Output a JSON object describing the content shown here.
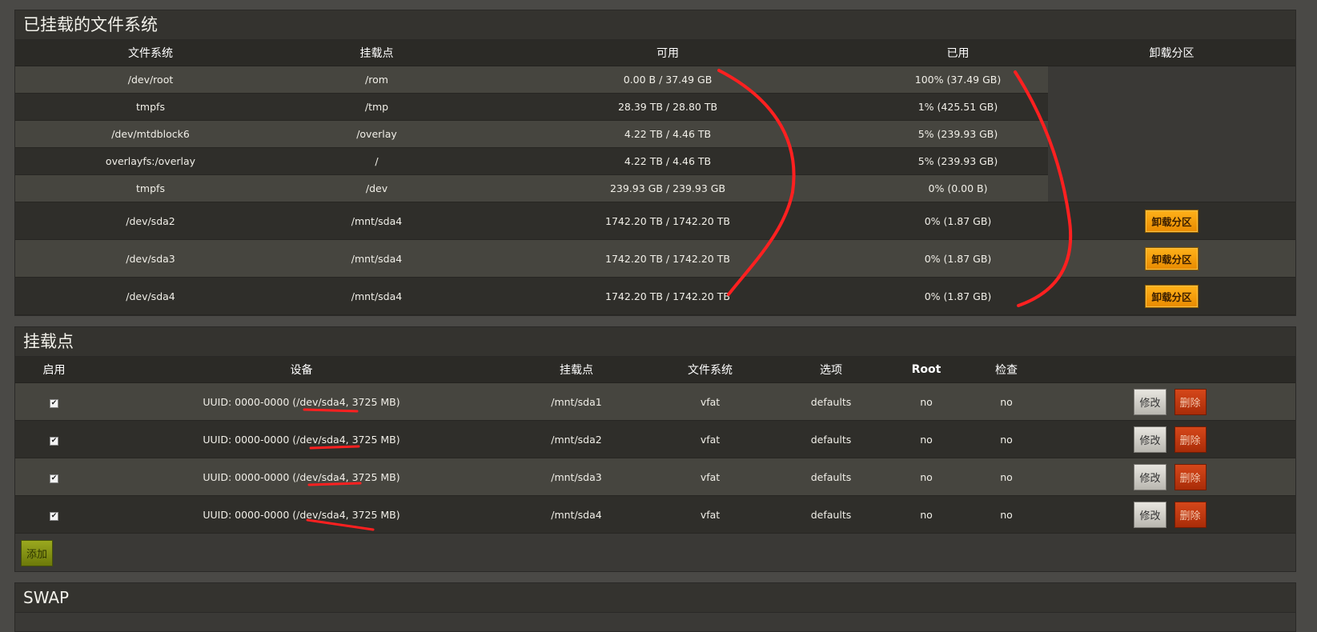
{
  "mounted": {
    "title": "已挂载的文件系统",
    "headers": [
      "文件系统",
      "挂载点",
      "可用",
      "已用",
      "卸载分区"
    ],
    "rows": [
      {
        "fs": "/dev/root",
        "mount": "/rom",
        "avail": "0.00 B / 37.49 GB",
        "used": "100% (37.49 GB)"
      },
      {
        "fs": "tmpfs",
        "mount": "/tmp",
        "avail": "28.39 TB / 28.80 TB",
        "used": "1% (425.51 GB)"
      },
      {
        "fs": "/dev/mtdblock6",
        "mount": "/overlay",
        "avail": "4.22 TB / 4.46 TB",
        "used": "5% (239.93 GB)"
      },
      {
        "fs": "overlayfs:/overlay",
        "mount": "/",
        "avail": "4.22 TB / 4.46 TB",
        "used": "5% (239.93 GB)"
      },
      {
        "fs": "tmpfs",
        "mount": "/dev",
        "avail": "239.93 GB / 239.93 GB",
        "used": "0% (0.00 B)"
      },
      {
        "fs": "/dev/sda2",
        "mount": "/mnt/sda4",
        "avail": "1742.20 TB / 1742.20 TB",
        "used": "0% (1.87 GB)",
        "action": "卸载分区"
      },
      {
        "fs": "/dev/sda3",
        "mount": "/mnt/sda4",
        "avail": "1742.20 TB / 1742.20 TB",
        "used": "0% (1.87 GB)",
        "action": "卸载分区"
      },
      {
        "fs": "/dev/sda4",
        "mount": "/mnt/sda4",
        "avail": "1742.20 TB / 1742.20 TB",
        "used": "0% (1.87 GB)",
        "action": "卸载分区"
      }
    ]
  },
  "mountpoints": {
    "title": "挂载点",
    "headers": [
      "启用",
      "设备",
      "挂载点",
      "文件系统",
      "选项",
      "Root",
      "检查",
      ""
    ],
    "rows": [
      {
        "enabled": true,
        "dev_prefix": "UUID: 0000-0000 (",
        "dev_path": "/dev/sda4",
        "dev_suffix": ", 3725 MB)",
        "mount": "/mnt/sda1",
        "fs": "vfat",
        "options": "defaults",
        "root": "no",
        "check": "no"
      },
      {
        "enabled": true,
        "dev_prefix": "UUID: 0000-0000 (",
        "dev_path": "/dev/sda4",
        "dev_suffix": ", 3725 MB)",
        "mount": "/mnt/sda2",
        "fs": "vfat",
        "options": "defaults",
        "root": "no",
        "check": "no"
      },
      {
        "enabled": true,
        "dev_prefix": "UUID: 0000-0000 (",
        "dev_path": "/dev/sda4",
        "dev_suffix": ", 3725 MB)",
        "mount": "/mnt/sda3",
        "fs": "vfat",
        "options": "defaults",
        "root": "no",
        "check": "no"
      },
      {
        "enabled": true,
        "dev_prefix": "UUID: 0000-0000 (",
        "dev_path": "/dev/sda4",
        "dev_suffix": ", 3725 MB)",
        "mount": "/mnt/sda4",
        "fs": "vfat",
        "options": "defaults",
        "root": "no",
        "check": "no"
      }
    ],
    "edit_label": "修改",
    "delete_label": "删除",
    "add_label": "添加"
  },
  "swap": {
    "title": "SWAP"
  },
  "colors": {
    "annotation": "#ff2020",
    "umount_button": "#f0a000",
    "delete_button": "#c0390f",
    "add_button": "#8a9815"
  }
}
